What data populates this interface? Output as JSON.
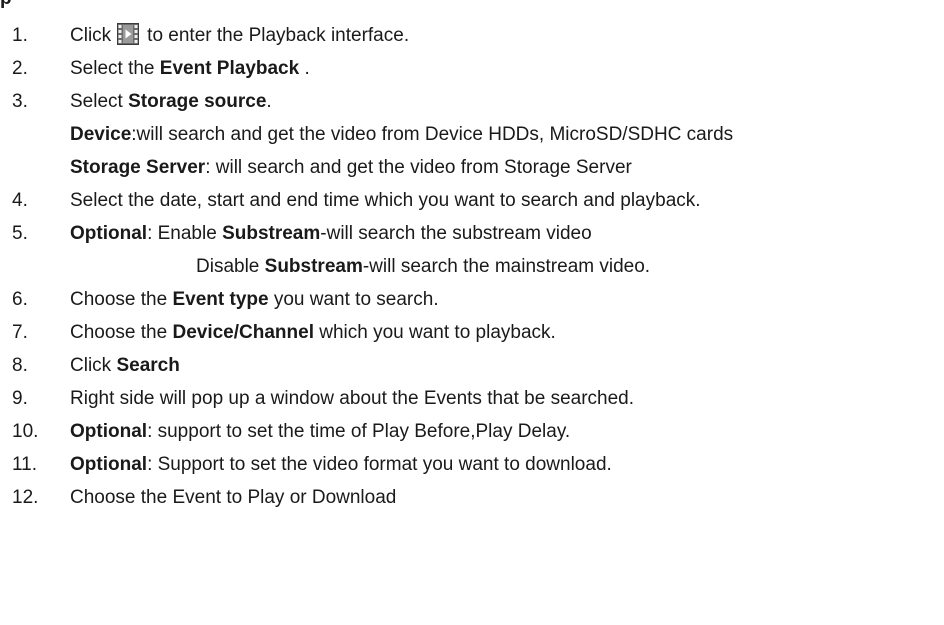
{
  "heading_fragment": "p",
  "steps": [
    {
      "num": "1.",
      "pre": "Click",
      "icon": "playback-film-icon",
      "post": "to enter the Playback interface."
    },
    {
      "num": "2.",
      "pre": "Select the ",
      "bold": "Event Playback",
      "post": " ."
    },
    {
      "num": "3.",
      "pre": "Select ",
      "bold": "Storage source",
      "post": "."
    },
    {
      "cont_bold": "Device",
      "cont_text": ":will search and get the video from Device HDDs, MicroSD/SDHC cards"
    },
    {
      "cont_bold": "Storage Server",
      "cont_text": ": will search and get the video from Storage Server"
    },
    {
      "num": "4.",
      "text": "Select the date, start and end time which you want to search and playback."
    },
    {
      "num": "5.",
      "bold": "Optional",
      "mid": ": Enable ",
      "bold2": "Substream",
      "post": "-will search the substream video"
    },
    {
      "pre": "Disable ",
      "bold": "Substream",
      "post": "-will search the mainstream video."
    },
    {
      "num": "6.",
      "pre": "Choose the ",
      "bold": "Event type",
      "post": " you want to search."
    },
    {
      "num": "7.",
      "pre": "Choose the ",
      "bold": "Device/Channel",
      "post": " which you want to playback."
    },
    {
      "num": "8.",
      "pre": "Click ",
      "bold": "Search"
    },
    {
      "num": "9.",
      "text": "Right side will pop up a window about the Events that be searched."
    },
    {
      "num": "10.",
      "bold": "Optional",
      "post": ": support to set the time of Play Before,Play Delay."
    },
    {
      "num": "11.",
      "bold": "Optional",
      "post": ": Support to set the video format you want to download."
    },
    {
      "num": "12.",
      "text": "Choose the Event to Play or Download"
    }
  ]
}
